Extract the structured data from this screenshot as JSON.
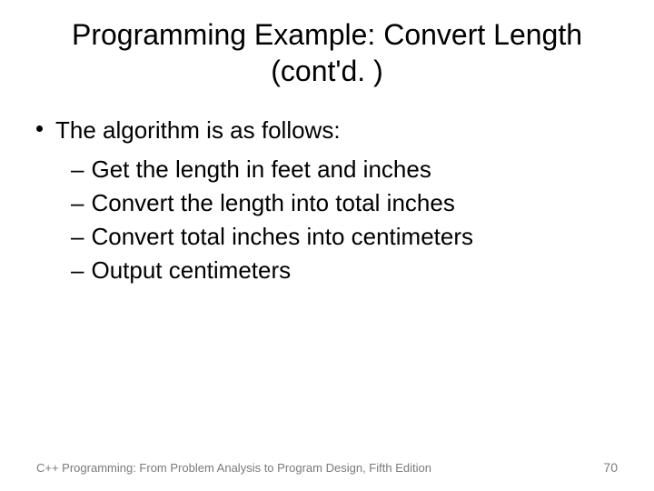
{
  "title": "Programming Example: Convert Length (cont'd. )",
  "intro": "The algorithm is as follows:",
  "steps": [
    "Get the length in feet and inches",
    "Convert the length into total inches",
    "Convert total inches into centimeters",
    "Output centimeters"
  ],
  "footer": {
    "source": "C++ Programming: From Problem Analysis to Program Design, Fifth Edition",
    "page": "70"
  },
  "dash": "–"
}
